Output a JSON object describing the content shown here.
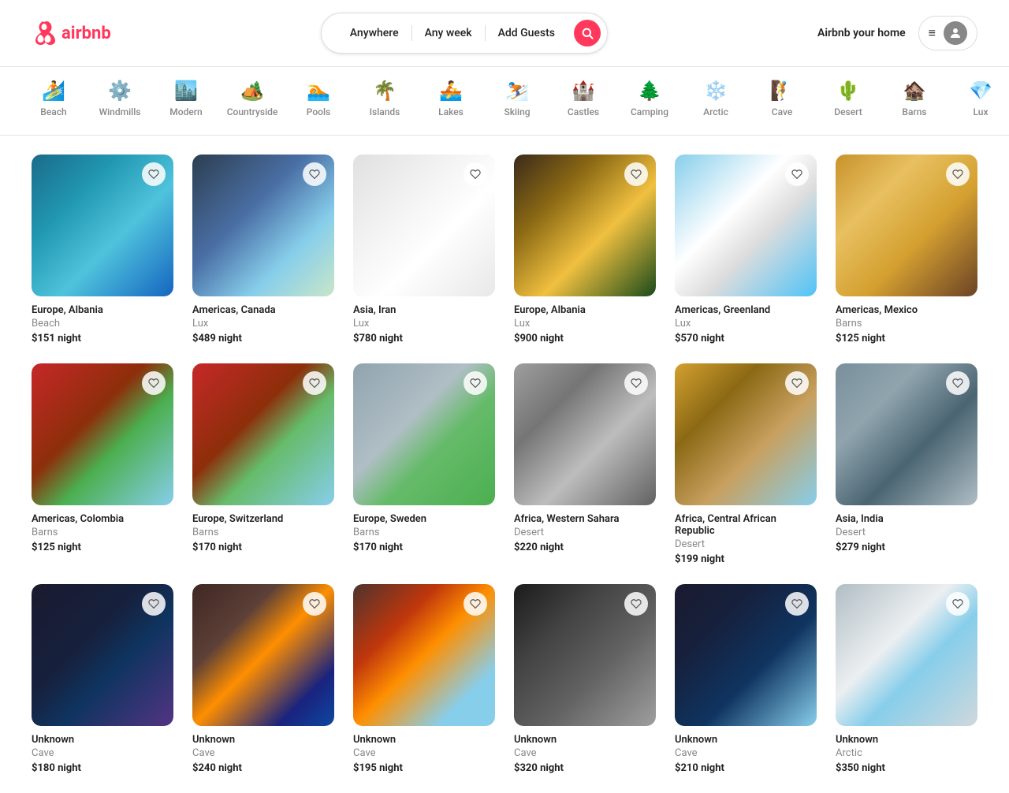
{
  "header": {
    "logo_text": "airbnb",
    "search": {
      "location_placeholder": "Anywhere",
      "week_placeholder": "Any week",
      "guests_placeholder": "Add Guests"
    },
    "airbnb_home": "Airbnb your home",
    "menu_icon": "≡"
  },
  "categories": [
    {
      "id": "beach",
      "label": "Beach",
      "icon": "🏄"
    },
    {
      "id": "windmills",
      "label": "Windmills",
      "icon": "⚙️"
    },
    {
      "id": "modern",
      "label": "Modern",
      "icon": "🏙️"
    },
    {
      "id": "countryside",
      "label": "Countryside",
      "icon": "🏕️"
    },
    {
      "id": "pools",
      "label": "Pools",
      "icon": "🏊"
    },
    {
      "id": "islands",
      "label": "Islands",
      "icon": "🌴"
    },
    {
      "id": "lakes",
      "label": "Lakes",
      "icon": "🚣"
    },
    {
      "id": "skiing",
      "label": "Skiing",
      "icon": "⛷️"
    },
    {
      "id": "castles",
      "label": "Castles",
      "icon": "🏰"
    },
    {
      "id": "camping",
      "label": "Camping",
      "icon": "🌲"
    },
    {
      "id": "arctic",
      "label": "Arctic",
      "icon": "❄️"
    },
    {
      "id": "cave",
      "label": "Cave",
      "icon": "🧗"
    },
    {
      "id": "desert",
      "label": "Desert",
      "icon": "🌵"
    },
    {
      "id": "barns",
      "label": "Barns",
      "icon": "🏚️"
    },
    {
      "id": "lux",
      "label": "Lux",
      "icon": "💎"
    }
  ],
  "listings": [
    {
      "location": "Europe, Albania",
      "type": "Beach",
      "type_color": "#FF385C",
      "price": "$151",
      "price_label": "night",
      "bg": "linear-gradient(135deg, #1a6b8a 0%, #2196b0 30%, #4fc3dc 60%, #1565c0 100%)"
    },
    {
      "location": "Americas, Canada",
      "type": "Lux",
      "type_color": "#FF385C",
      "price": "$489",
      "price_label": "night",
      "bg": "linear-gradient(135deg, #2c3e50 0%, #4a6fa5 40%, #87CEEB 70%, #c8e6c9 100%)"
    },
    {
      "location": "Asia, Iran",
      "type": "Lux",
      "type_color": "#FF385C",
      "price": "$780",
      "price_label": "night",
      "bg": "linear-gradient(135deg, #e0e0e0 0%, #f5f5f5 40%, #fff 60%, #e8e8e8 100%)"
    },
    {
      "location": "Europe, Albania",
      "type": "Lux",
      "type_color": "#FF385C",
      "price": "$900",
      "price_label": "night",
      "bg": "linear-gradient(135deg, #3a2a1a 0%, #8B6914 30%, #f0c040 60%, #1a4a1a 100%)"
    },
    {
      "location": "Americas, Greenland",
      "type": "Lux",
      "type_color": "#FF385C",
      "price": "$570",
      "price_label": "night",
      "bg": "linear-gradient(135deg, #87CEEB 0%, #fff 40%, #ddd 60%, #4fc3f7 100%)"
    },
    {
      "location": "Americas, Mexico",
      "type": "Barns",
      "type_color": "#FF385C",
      "price": "$125",
      "price_label": "night",
      "bg": "linear-gradient(135deg, #c8922a 0%, #e8c060 30%, #d4a030 60%, #6b4226 100%)"
    },
    {
      "location": "Americas, Colombia",
      "type": "Barns",
      "type_color": "#FF385C",
      "price": "$125",
      "price_label": "night",
      "bg": "linear-gradient(135deg, #c62828 0%, #8d2e0a 40%, #4caf50 60%, #87CEEB 100%)"
    },
    {
      "location": "Europe, Switzerland",
      "type": "Barns",
      "type_color": "#FF385C",
      "price": "$170",
      "price_label": "night",
      "bg": "linear-gradient(135deg, #c62828 0%, #8d2e0a 40%, #66bb6a 60%, #87CEEB 100%)"
    },
    {
      "location": "Europe, Sweden",
      "type": "Barns",
      "type_color": "#FF385C",
      "price": "$170",
      "price_label": "night",
      "bg": "linear-gradient(135deg, #90a4ae 0%, #b0bec5 40%, #66bb6a 60%, #4caf50 100%)"
    },
    {
      "location": "Africa, Western Sahara",
      "type": "Desert",
      "type_color": "#FF385C",
      "price": "$220",
      "price_label": "night",
      "bg": "linear-gradient(135deg, #9e9e9e 0%, #757575 30%, #bdbdbd 60%, #616161 100%)"
    },
    {
      "location": "Africa, Central African Republic",
      "type": "Desert",
      "type_color": "#FF385C",
      "price": "$199",
      "price_label": "night",
      "bg": "linear-gradient(135deg, #d4a030 0%, #8B6914 30%, #c8a060 60%, #87CEEB 100%)"
    },
    {
      "location": "Asia, India",
      "type": "Desert",
      "type_color": "#FF385C",
      "price": "$279",
      "price_label": "night",
      "bg": "linear-gradient(135deg, #78909c 0%, #90a4ae 30%, #4a6572 60%, #b0bec5 100%)"
    },
    {
      "location": "Unknown",
      "type": "Cave",
      "type_color": "#FF385C",
      "price": "$180",
      "price_label": "night",
      "bg": "linear-gradient(135deg, #1a1a2e 0%, #16213e 40%, #0f3460 60%, #533483 100%)"
    },
    {
      "location": "Unknown",
      "type": "Cave",
      "type_color": "#FF385C",
      "price": "$240",
      "price_label": "night",
      "bg": "linear-gradient(135deg, #3e2723 0%, #5d4037 30%, #ff8f00 50%, #1a237e 80%, #0d47a1 100%)"
    },
    {
      "location": "Unknown",
      "type": "Cave",
      "type_color": "#FF385C",
      "price": "$195",
      "price_label": "night",
      "bg": "linear-gradient(135deg, #4e342e 0%, #bf360c 30%, #ff8f00 50%, #87CEEB 80%)"
    },
    {
      "location": "Unknown",
      "type": "Cave",
      "type_color": "#FF385C",
      "price": "$320",
      "price_label": "night",
      "bg": "linear-gradient(135deg, #1b1b1b 0%, #424242 30%, #616161 60%, #9e9e9e 100%)"
    },
    {
      "location": "Unknown",
      "type": "Cave",
      "type_color": "#FF385C",
      "price": "$210",
      "price_label": "night",
      "bg": "linear-gradient(135deg, #1a1a2e 0%, #16213e 30%, #0f3460 60%, #87CEEB 100%)"
    },
    {
      "location": "Unknown",
      "type": "Arctic",
      "type_color": "#FF385C",
      "price": "$350",
      "price_label": "night",
      "bg": "linear-gradient(135deg, #b0bec5 0%, #eceff1 40%, #87CEEB 60%, #cfd8dc 100%)"
    }
  ]
}
